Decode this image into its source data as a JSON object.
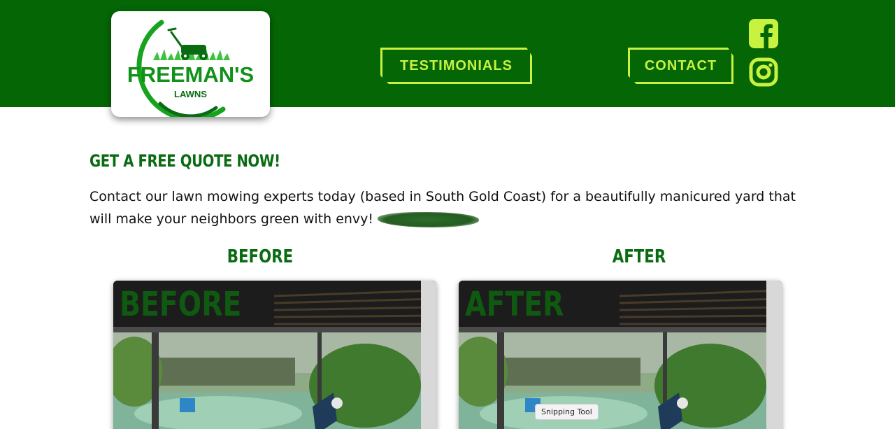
{
  "header": {
    "logo": {
      "brand": "FREEMAN'S",
      "sub": "LAWNS"
    },
    "nav": [
      {
        "label": "TESTIMONIALS"
      },
      {
        "label": "CONTACT"
      }
    ],
    "social": [
      {
        "icon": "facebook-icon"
      },
      {
        "icon": "instagram-icon"
      }
    ],
    "colors": {
      "bar": "#056605",
      "accent": "#c7f23f"
    }
  },
  "main": {
    "title": "GET A FREE QUOTE NOW!",
    "intro": "Contact our lawn mowing experts today (based in South Gold Coast) for a beautifully manicured yard that will make your neighbors green with envy!",
    "columns": [
      {
        "heading": "BEFORE",
        "photo_label": "BEFORE"
      },
      {
        "heading": "AFTER",
        "photo_label": "AFTER"
      }
    ]
  },
  "tooltip": "Snipping Tool"
}
